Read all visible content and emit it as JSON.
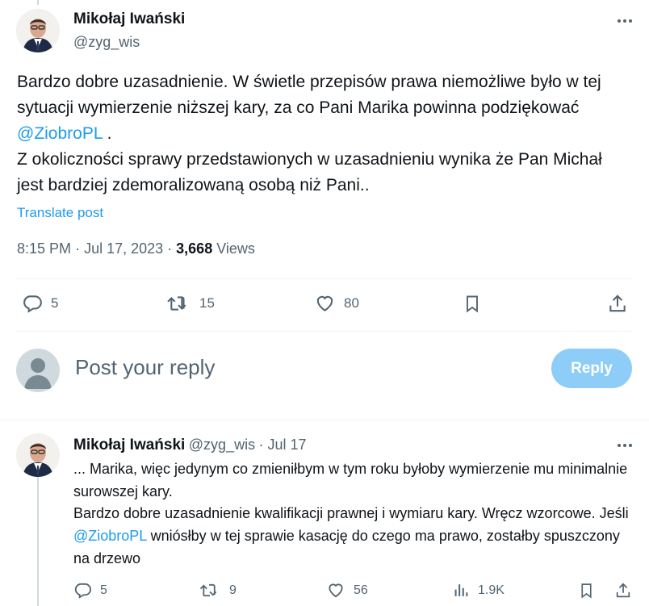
{
  "main_tweet": {
    "author_name": "Mikołaj Iwański",
    "author_handle": "@zyg_wis",
    "text_p1_before": "Bardzo dobre uzasadnienie. W świetle przepisów prawa niemożliwe było w tej sytuacji wymierzenie niższej kary, za co Pani Marika powinna podziękować ",
    "mention": "@ZiobroPL",
    "text_p1_after": " .",
    "text_p2": "Z okoliczności sprawy przedstawionych w uzasadnieniu wynika że Pan Michał jest bardziej zdemoralizowaną osobą niż Pani..",
    "translate_label": "Translate post",
    "time": "8:15 PM",
    "date": "Jul 17, 2023",
    "views_count": "3,668",
    "views_label": "Views",
    "replies": "5",
    "reposts": "15",
    "likes": "80"
  },
  "composer": {
    "placeholder": "Post your reply",
    "reply_button": "Reply"
  },
  "reply_tweet": {
    "author_name": "Mikołaj Iwański",
    "author_handle": "@zyg_wis",
    "date": "Jul 17",
    "line1": "... Marika, więc jedynym co zmieniłbym w tym roku byłoby wymierzenie mu minimalnie surowszej kary.",
    "line2": "Bardzo dobre uzasadnienie kwalifikacji prawnej i wymiaru kary. Wręcz wzorcowe. Jeśli ",
    "mention": "@ZiobroPL",
    "line2_after": " wniósłby w tej sprawie kasację do czego ma prawo, zostałby spuszczony na drzewo",
    "replies": "5",
    "reposts": "9",
    "likes": "56",
    "views": "1.9K"
  },
  "icons": {
    "reply": "reply-icon",
    "repost": "repost-icon",
    "like": "heart-icon",
    "bookmark": "bookmark-icon",
    "share": "share-icon",
    "views": "views-icon",
    "more": "more-icon"
  },
  "colors": {
    "accent": "#1d9bf0",
    "reply_button_disabled": "#8ecdf8",
    "secondary_text": "#536471"
  }
}
